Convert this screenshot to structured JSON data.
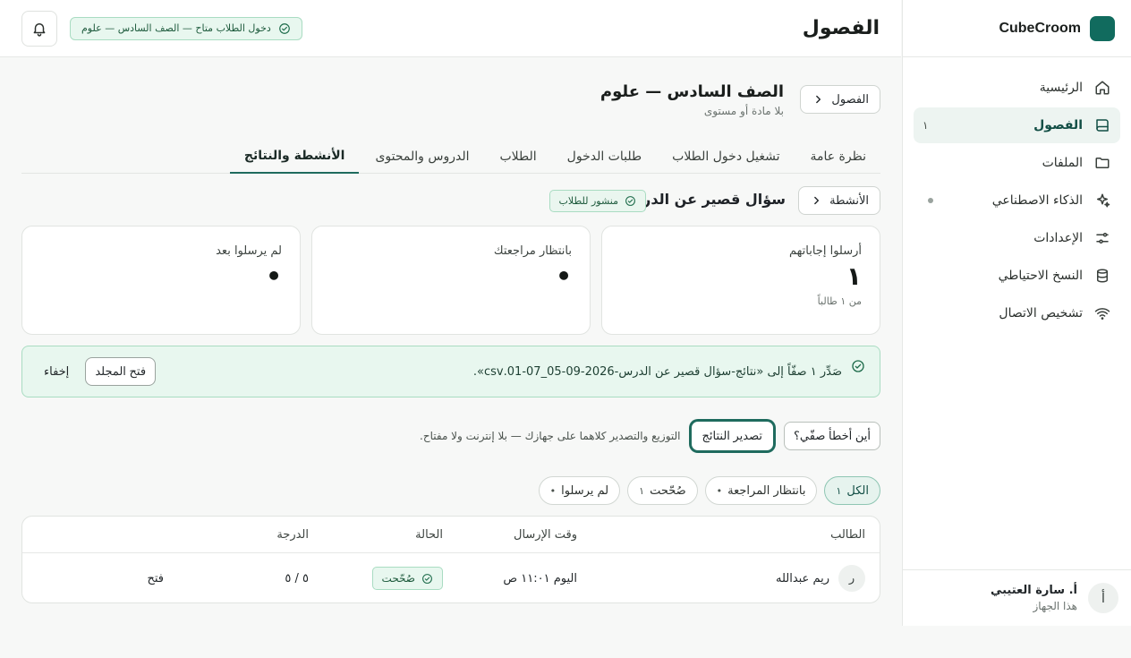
{
  "app": {
    "brand": "CubeCroom",
    "brand_color": "#116b5e"
  },
  "sidebar": {
    "items": [
      {
        "label": "الرئيسية",
        "icon": "home-icon",
        "count": "",
        "active": false
      },
      {
        "label": "الفصول",
        "icon": "book-icon",
        "count": "١",
        "active": true
      },
      {
        "label": "الملفات",
        "icon": "folder-icon",
        "count": "",
        "active": false
      },
      {
        "label": "الذكاء الاصطناعي",
        "icon": "sparkles-icon",
        "count": "",
        "active": false
      },
      {
        "label": "الإعدادات",
        "icon": "sliders-icon",
        "count": "",
        "active": false
      },
      {
        "label": "النسخ الاحتياطي",
        "icon": "database-icon",
        "count": "",
        "active": false
      },
      {
        "label": "تشخيص الاتصال",
        "icon": "wifi-icon",
        "count": "",
        "active": false
      }
    ],
    "user": {
      "initial": "أ",
      "name": "أ. سارة العتيبي",
      "sub": "هذا الجهاز"
    }
  },
  "topbar": {
    "title": "الفصول",
    "session_pill": "دخول الطلاب متاح — الصف السادس — علوم"
  },
  "class": {
    "back_label": "الفصول",
    "title": "الصف السادس — علوم",
    "subtitle": "بلا مادة أو مستوى"
  },
  "tabs": [
    {
      "label": "نظرة عامة",
      "active": false
    },
    {
      "label": "تشغيل دخول الطلاب",
      "active": false
    },
    {
      "label": "طلبات الدخول",
      "active": false
    },
    {
      "label": "الطلاب",
      "active": false
    },
    {
      "label": "الدروس والمحتوى",
      "active": false
    },
    {
      "label": "الأنشطة والنتائج",
      "active": true
    }
  ],
  "activity": {
    "back_label": "الأنشطة",
    "title": "سؤال قصير عن الدرس",
    "badge": "منشور للطلاب"
  },
  "stats": [
    {
      "label": "أرسلوا إجاباتهم",
      "value": "١",
      "sub": "من ١ طالباً"
    },
    {
      "label": "بانتظار مراجعتك",
      "value": "•",
      "sub": ""
    },
    {
      "label": "لم يرسلوا بعد",
      "value": "•",
      "sub": ""
    }
  ],
  "banner": {
    "text": "صَدِّر ١ صفّاً إلى «نتائج-سؤال قصير عن الدرس-2026-09-05_07-01.csv».",
    "open_folder": "فتح المجلد",
    "hide": "إخفاء"
  },
  "export": {
    "where_button": "أين أخطأ صفّي؟",
    "export_button": "تصدير النتائج",
    "note": "التوزيع والتصدير كلاهما على جهازك — بلا إنترنت ولا مفتاح."
  },
  "filters": [
    {
      "label": "الكل",
      "count": "١",
      "active": true
    },
    {
      "label": "بانتظار المراجعة",
      "count": "•",
      "active": false
    },
    {
      "label": "صُحّحت",
      "count": "١",
      "active": false
    },
    {
      "label": "لم يرسلوا",
      "count": "•",
      "active": false
    }
  ],
  "table": {
    "headers": {
      "student": "الطالب",
      "sent": "وقت الإرسال",
      "status": "الحالة",
      "grade": "الدرجة"
    },
    "rows": [
      {
        "initial": "ر",
        "student": "ريم عبدالله",
        "sent": "اليوم ١١:٠١ ص",
        "status": "صُحّحت",
        "grade": "٥ / ٥",
        "action": "فتح"
      }
    ]
  },
  "colors": {
    "accent": "#1f6b5e",
    "success_bg": "#e8f7ef",
    "success_border": "#a9dcc2"
  }
}
